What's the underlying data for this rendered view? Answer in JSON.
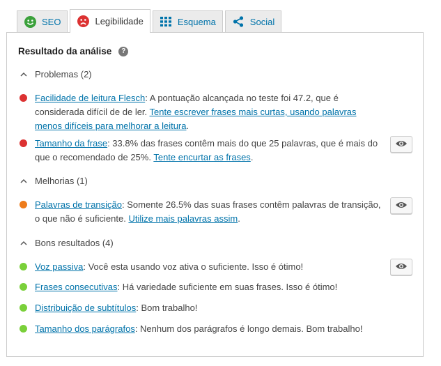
{
  "tabs": [
    {
      "label": "SEO",
      "icon": "smiley-happy-icon",
      "color": "#3ba13b"
    },
    {
      "label": "Legibilidade",
      "icon": "smiley-sad-icon",
      "color": "#dc3232"
    },
    {
      "label": "Esquema",
      "icon": "grid-icon",
      "color": "#0073aa"
    },
    {
      "label": "Social",
      "icon": "share-icon",
      "color": "#0073aa"
    }
  ],
  "panel": {
    "title": "Resultado da análise",
    "help_glyph": "?",
    "groups": {
      "problems": "Problemas (2)",
      "improvements": "Melhorias (1)",
      "good": "Bons resultados (4)"
    },
    "items": [
      {
        "status": "red",
        "link": "Facilidade de leitura Flesch",
        "text": ": A pontuação alcançada no teste foi 47.2, que é considerada difícil de de ler. ",
        "action": "Tente escrever frases mais curtas, usando palavras menos difíceis para melhorar a leitura",
        "tail": "."
      },
      {
        "status": "red",
        "link": "Tamanho da frase",
        "text": ": 33.8% das frases contêm mais do que 25 palavras, que é mais do que o recomendado de 25%. ",
        "action": "Tente encurtar as frases",
        "tail": "."
      },
      {
        "status": "orange",
        "link": "Palavras de transição",
        "text": ": Somente 26.5% das suas frases contêm palavras de transição, o que não é suficiente. ",
        "action": "Utilize mais palavras assim",
        "tail": "."
      },
      {
        "status": "green",
        "link": "Voz passiva",
        "text": ": Você esta usando voz ativa o suficiente. Isso é ótimo!"
      },
      {
        "status": "green",
        "link": "Frases consecutivas",
        "text": ": Há variedade suficiente em suas frases. Isso é ótimo!"
      },
      {
        "status": "green",
        "link": "Distribuição de subtítulos",
        "text": ": Bom trabalho!"
      },
      {
        "status": "green",
        "link": "Tamanho dos parágrafos",
        "text": ": Nenhum dos parágrafos é longo demais. Bom trabalho!"
      }
    ]
  },
  "colors": {
    "red": "#dc3232",
    "orange": "#ee7c1b",
    "green": "#7ad03a",
    "link": "#0073aa"
  }
}
